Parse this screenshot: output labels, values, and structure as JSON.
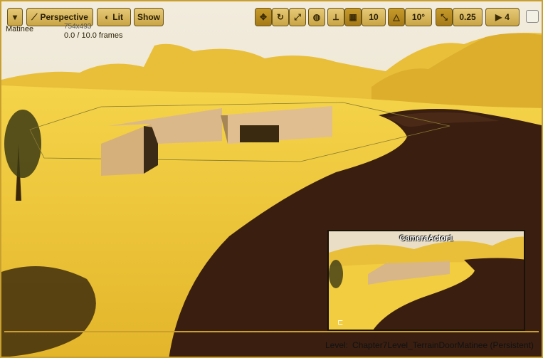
{
  "viewport": {
    "view_mode_label": "Perspective",
    "lighting_label": "Lit",
    "show_label": "Show",
    "matinee_label": "Matinee",
    "resolution_text": "754x493",
    "frames_text": "0.0 / 10.0 frames"
  },
  "toolbar": {
    "menu_icon": "chevron-down-icon",
    "grid_snap_value": "10",
    "rotation_snap_value": "10°",
    "scale_snap_value": "0.25",
    "camera_speed_value": "4"
  },
  "pip": {
    "title": "CameraActor1"
  },
  "status": {
    "level_label": "Level:",
    "level_name": "Chapter7Level_TerrainDoorMatinee (Persistent)"
  },
  "colors": {
    "ui_accent": "#c9a030",
    "terrain": "#f0c93a",
    "river": "#3a1e10"
  }
}
